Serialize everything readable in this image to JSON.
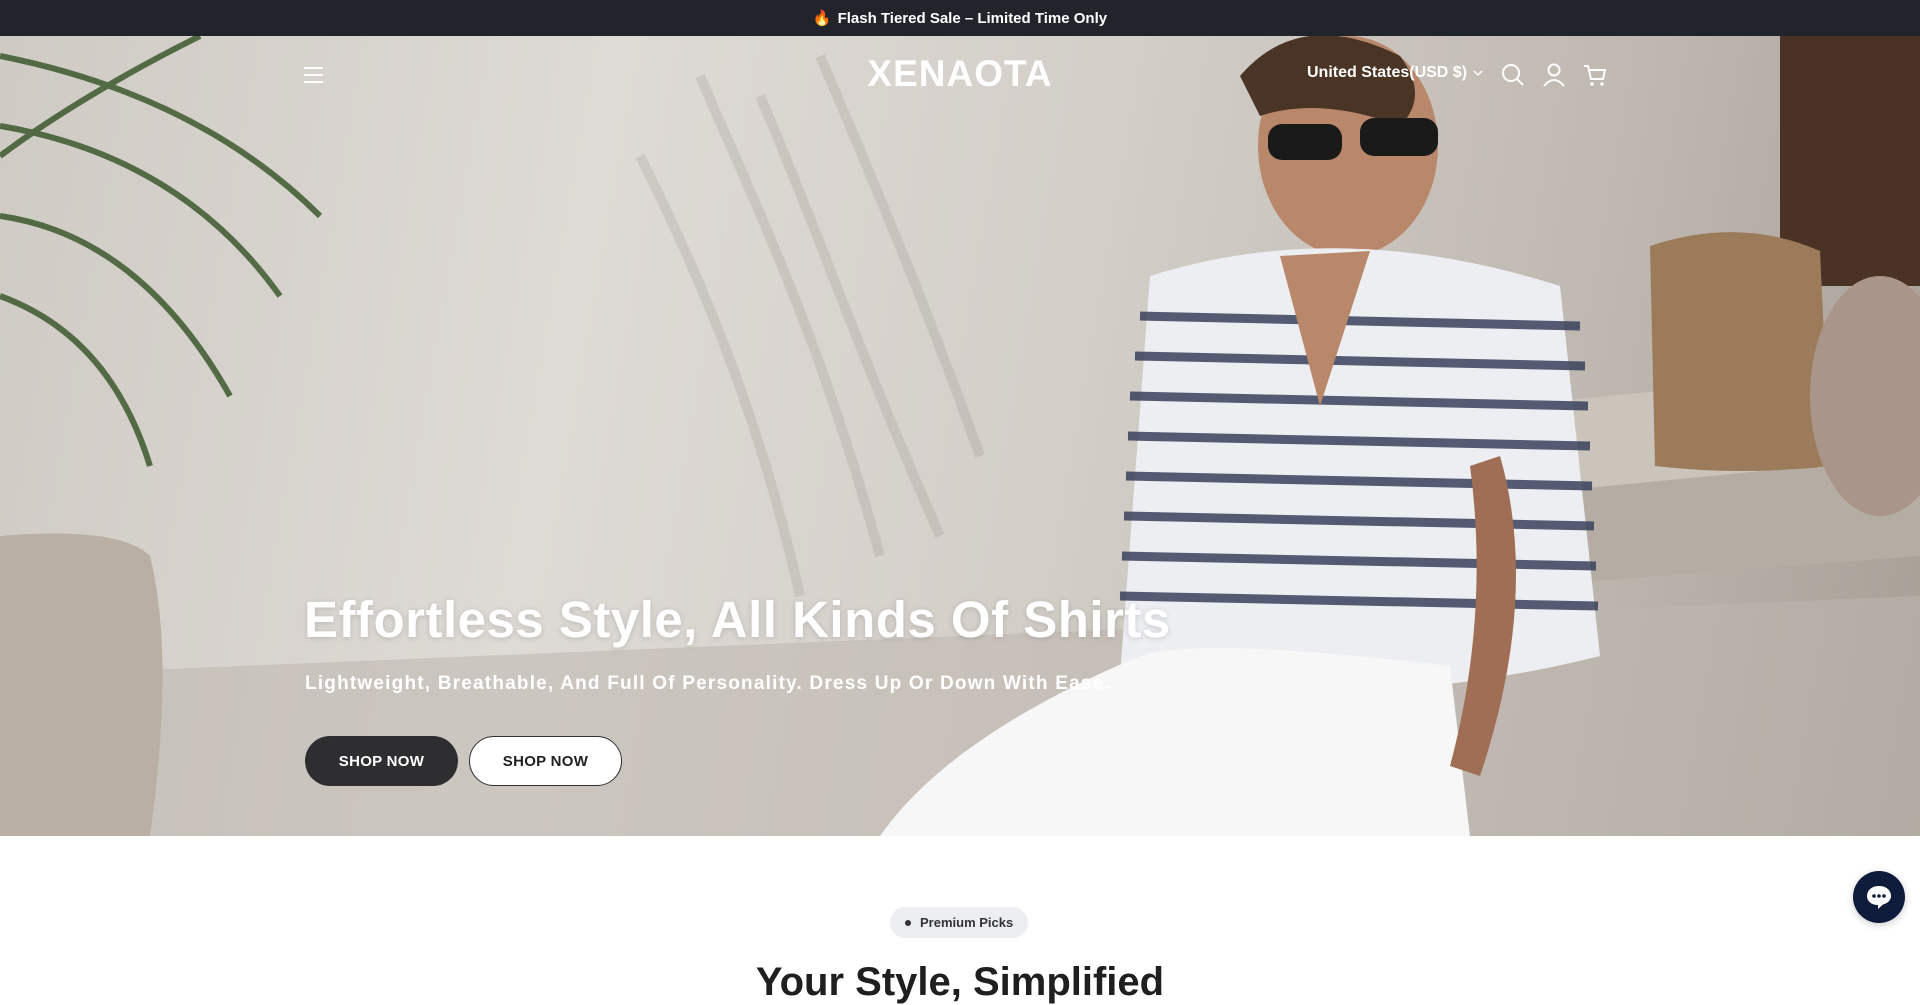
{
  "announcement": {
    "icon": "fire-icon",
    "flame_glyph": "🔥",
    "text": "Flash Tiered Sale – Limited Time Only"
  },
  "header": {
    "logo": "XENAOTA",
    "locale": "United States(USD $)",
    "icons": [
      "menu-icon",
      "search-icon",
      "account-icon",
      "cart-icon"
    ]
  },
  "hero": {
    "title": "Effortless Style, All Kinds Of Shirts",
    "subtitle": "Lightweight, Breathable, And Full Of Personality. Dress Up Or Down With Ease.",
    "primary_button": "SHOP NOW",
    "secondary_button": "SHOP NOW"
  },
  "collection": {
    "badge": "Premium Picks",
    "title": "Your Style, Simplified"
  },
  "chat": {
    "icon": "chat-bubble-icon"
  },
  "colors": {
    "announcement_bg": "#22242c",
    "primary_button_bg": "#2e2e30",
    "badge_bg": "#eceef1",
    "chat_bg": "#0f1b3a"
  }
}
